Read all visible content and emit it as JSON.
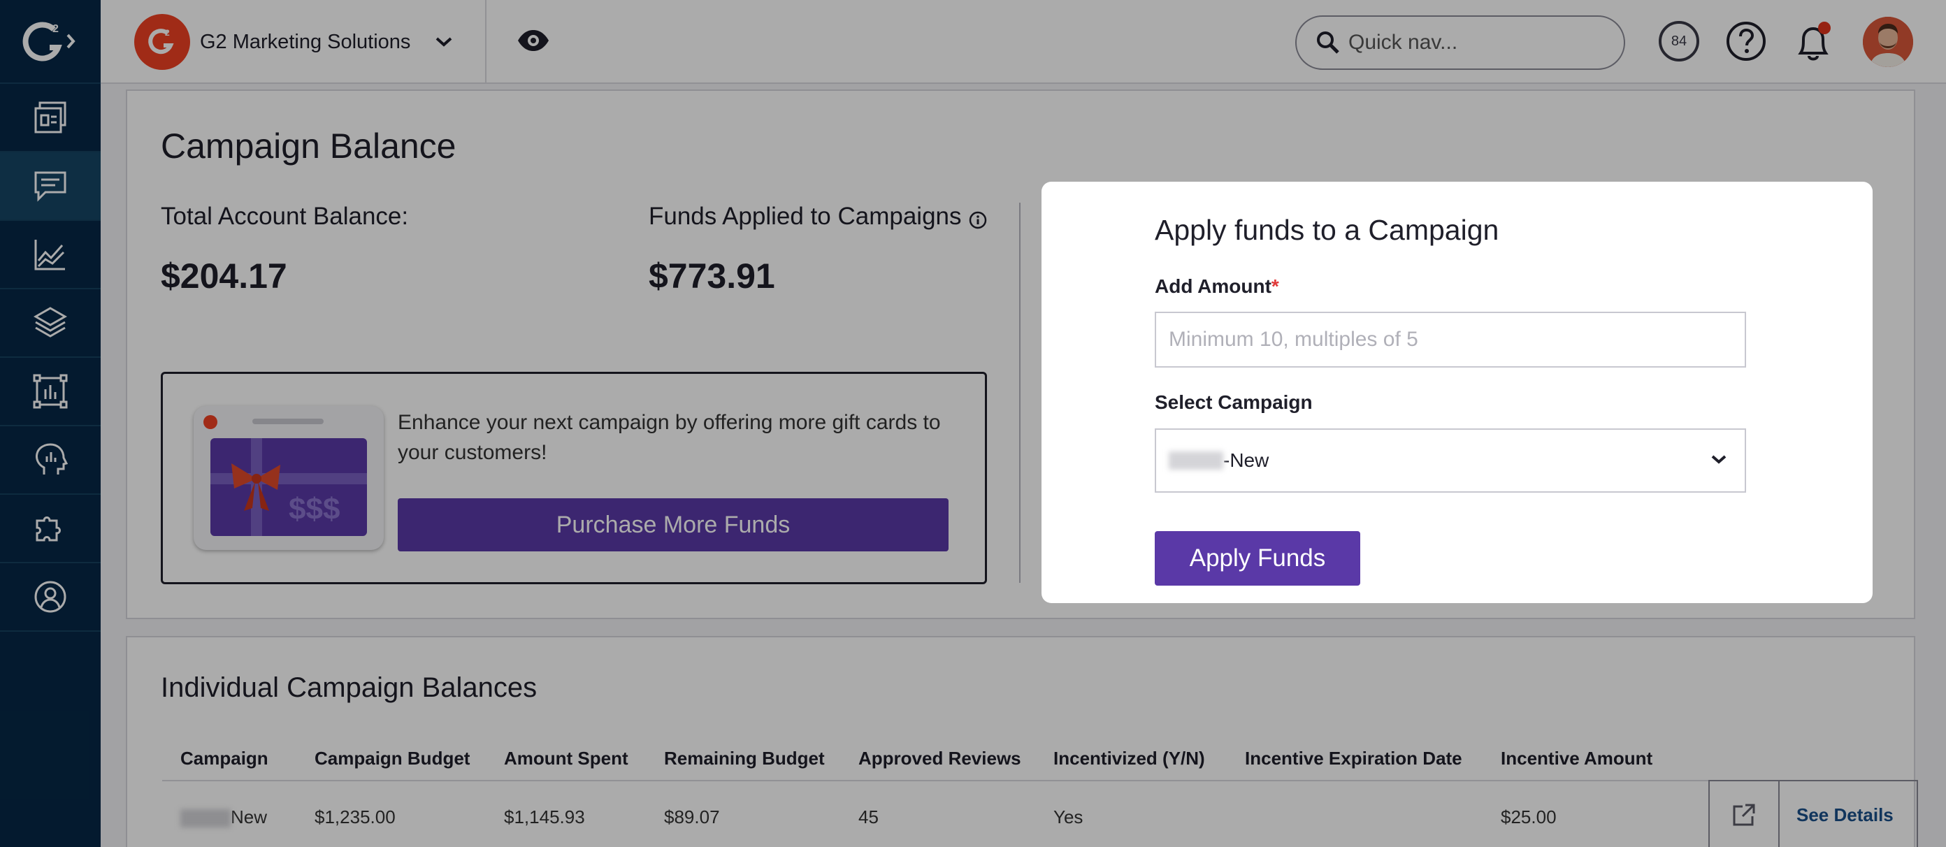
{
  "topbar": {
    "org_name": "G2 Marketing Solutions",
    "search_placeholder": "Quick nav...",
    "score": "84"
  },
  "sidebar": {
    "items": [
      {
        "icon": "products-icon"
      },
      {
        "icon": "reviews-icon"
      },
      {
        "icon": "analytics-icon"
      },
      {
        "icon": "layers-icon"
      },
      {
        "icon": "reports-icon"
      },
      {
        "icon": "insights-icon"
      },
      {
        "icon": "integrations-icon"
      },
      {
        "icon": "account-icon"
      }
    ],
    "active_index": 1
  },
  "balance": {
    "title": "Campaign Balance",
    "total_label": "Total Account Balance:",
    "total_value": "$204.17",
    "applied_label": "Funds Applied to Campaigns",
    "applied_value": "$773.91"
  },
  "promo": {
    "text": "Enhance your next campaign by offering more gift cards to your customers!",
    "button": "Purchase More Funds",
    "card_text": "$$$"
  },
  "modal": {
    "title": "Apply funds to a Campaign",
    "amount_label": "Add Amount",
    "required_mark": "*",
    "amount_placeholder": "Minimum 10, multiples of 5",
    "campaign_label": "Select Campaign",
    "campaign_value": "-New",
    "apply_button": "Apply Funds"
  },
  "campaigns": {
    "title": "Individual Campaign Balances",
    "headers": [
      "Campaign",
      "Campaign Budget",
      "Amount Spent",
      "Remaining Budget",
      "Approved Reviews",
      "Incentivized (Y/N)",
      "Incentive Expiration Date",
      "Incentive Amount"
    ],
    "rows": [
      {
        "campaign": "New",
        "budget": "$1,235.00",
        "spent": "$1,145.93",
        "remaining": "$89.07",
        "reviews": "45",
        "incentivized": "Yes",
        "expiration": "",
        "amount": "$25.00",
        "action": "See Details"
      }
    ]
  },
  "colors": {
    "sidebar": "#062846",
    "primary": "#5a39a7",
    "brand": "#ef4123",
    "link": "#1a4f8a"
  }
}
